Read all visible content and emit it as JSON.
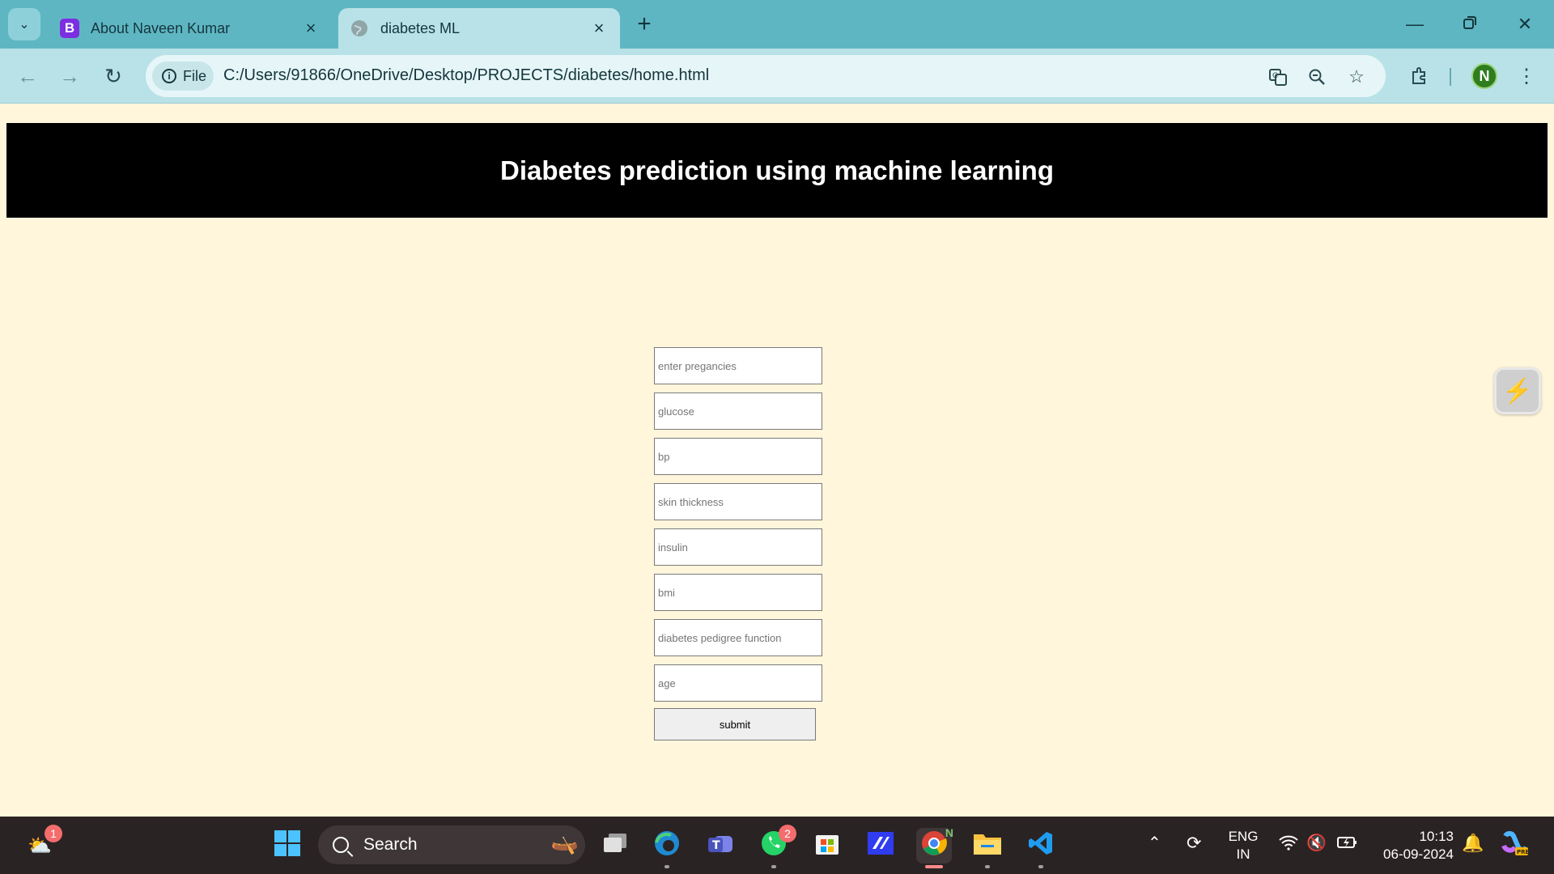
{
  "browser": {
    "tabs": [
      {
        "title": "About Naveen Kumar",
        "favicon": "B"
      },
      {
        "title": "diabetes ML"
      }
    ],
    "site_info_label": "File",
    "url": "C:/Users/91866/OneDrive/Desktop/PROJECTS/diabetes/home.html",
    "profile_initial": "N"
  },
  "page": {
    "heading": "Diabetes prediction using machine learning",
    "fields": [
      {
        "placeholder": "enter pregancies"
      },
      {
        "placeholder": "glucose"
      },
      {
        "placeholder": "bp"
      },
      {
        "placeholder": "skin thickness"
      },
      {
        "placeholder": "insulin"
      },
      {
        "placeholder": "bmi"
      },
      {
        "placeholder": "diabetes pedigree function"
      },
      {
        "placeholder": "age"
      }
    ],
    "submit_label": "submit"
  },
  "taskbar": {
    "weather_badge": "1",
    "search_label": "Search",
    "whatsapp_badge": "2",
    "chrome_profile_initial": "N",
    "language": "ENG",
    "region": "IN",
    "time": "10:13",
    "date": "06-09-2024"
  },
  "colors": {
    "tabbar": "#5fb6c3",
    "toolbar": "#b8e2e7",
    "page_background": "#fff6dc",
    "banner": "#000000",
    "taskbar": "#2a2324"
  }
}
